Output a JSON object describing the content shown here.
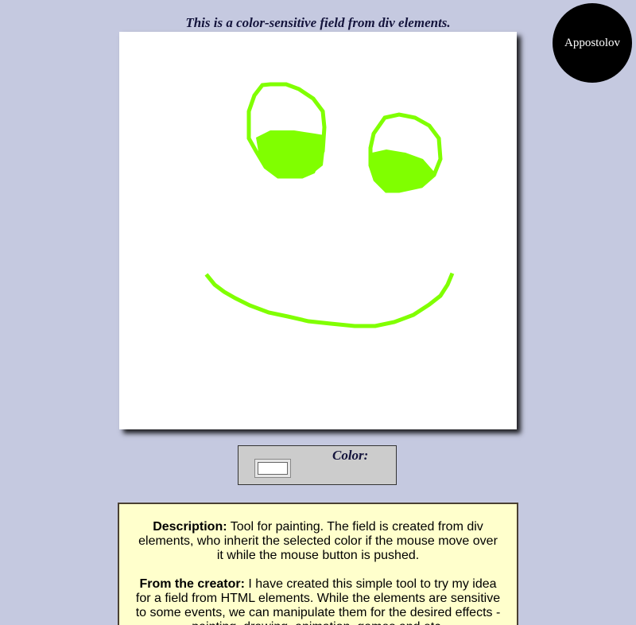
{
  "headline": "This is a color-sensitive field from div elements.",
  "badge": {
    "label": "Appostolov"
  },
  "paint_color": "#80ff00",
  "field_background": "#ffffff",
  "color_panel": {
    "label": "Color:",
    "selected_color": "#ffffff"
  },
  "description": {
    "desc_heading": "Description:",
    "desc_text": " Tool for painting. The field is created from div elements, who inherit the selected color if the mouse move over it while the mouse button is pushed.",
    "creator_heading": "From the creator:",
    "creator_text": " I have created this simple tool to try my idea for a field from HTML elements. While the elements are sensitive to some events, we can manipulate them for the desired effects - painting, drawing, animation, games and etc."
  }
}
